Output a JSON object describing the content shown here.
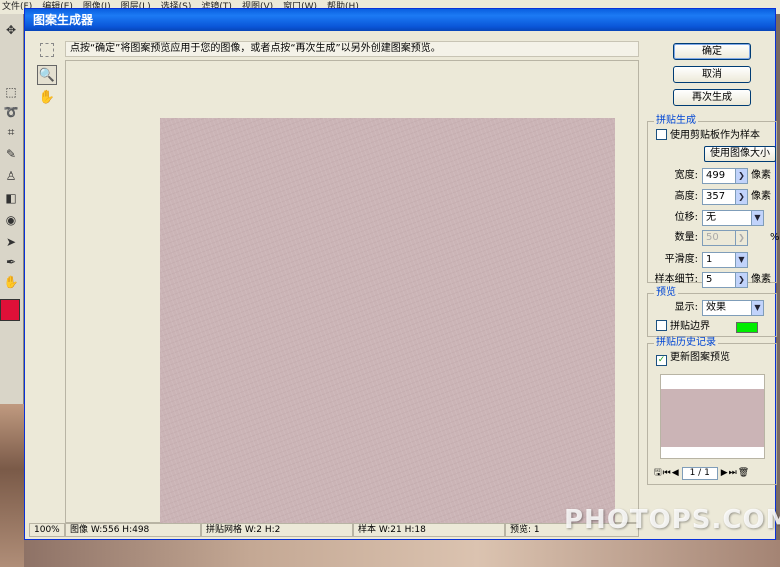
{
  "ps_menu": [
    "文件(F)",
    "编辑(E)",
    "图像(I)",
    "图层(L)",
    "选择(S)",
    "滤镜(T)",
    "视图(V)",
    "窗口(W)",
    "帮助(H)"
  ],
  "dialog": {
    "title": "图案生成器",
    "instruction": "点按“确定”将图案预览应用于您的图像，或者点按“再次生成”以另外创建图案预览。",
    "pattern_color": "#cbb4b6"
  },
  "buttons": {
    "ok": "确定",
    "cancel": "取消",
    "regenerate": "再次生成"
  },
  "tile": {
    "title": "拼贴生成",
    "use_clipboard": "使用剪贴板作为样本",
    "use_image_size": "使用图像大小",
    "width_label": "宽度:",
    "width_value": "499",
    "width_unit": "像素",
    "height_label": "高度:",
    "height_value": "357",
    "height_unit": "像素",
    "offset_label": "位移:",
    "offset_value": "无",
    "amount_label": "数量:",
    "amount_value": "50",
    "amount_unit": "%",
    "smoothness_label": "平滑度:",
    "smoothness_value": "1",
    "sample_detail_label": "样本细节:",
    "sample_detail_value": "5",
    "sample_detail_unit": "像素"
  },
  "preview": {
    "title": "预览",
    "show_label": "显示:",
    "show_value": "效果",
    "tile_boundaries": "拼贴边界",
    "boundary_color": "#00ee00"
  },
  "history": {
    "title": "拼贴历史记录",
    "update_preview": "更新图案预览",
    "update_checked_mark": "✓",
    "page": "1 / 1"
  },
  "status": {
    "zoom": "100%",
    "image": "图像 W:556 H:498",
    "grid": "拼贴网格 W:2 H:2",
    "sample": "样本 W:21 H:18",
    "preview": "预览: 1"
  },
  "watermark": "PHOTOPS.COM"
}
